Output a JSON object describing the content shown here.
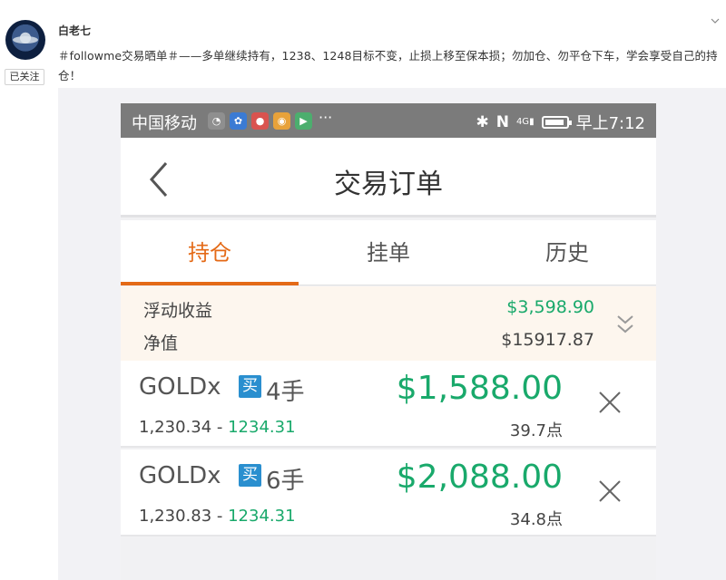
{
  "post": {
    "username": "白老七",
    "follow_label": "已关注",
    "text": "＃followme交易晒单＃——多单继续持有，1238、1248目标不变，止损上移至保本损；勿加仓、勿平仓下车，学会享受自己的持仓！"
  },
  "phone": {
    "status_bar": {
      "carrier": "中国移动",
      "more": "···",
      "network": "4G",
      "time": "早上7:12"
    },
    "title": "交易订单",
    "tabs": [
      {
        "label": "持仓",
        "active": true
      },
      {
        "label": "挂单",
        "active": false
      },
      {
        "label": "历史",
        "active": false
      }
    ],
    "summary": {
      "floating_label": "浮动收益",
      "floating_value": "$3,598.90",
      "equity_label": "净值",
      "equity_value": "$15917.87"
    },
    "orders": [
      {
        "symbol": "GOLDx",
        "side": "买",
        "lots": "4手",
        "profit": "$1,588.00",
        "open": "1,230.34",
        "sep": " - ",
        "target": "1234.31",
        "points": "39.7点"
      },
      {
        "symbol": "GOLDx",
        "side": "买",
        "lots": "6手",
        "profit": "$2,088.00",
        "open": "1,230.83",
        "sep": " - ",
        "target": "1234.31",
        "points": "34.8点"
      }
    ]
  },
  "colors": {
    "accent_orange": "#e46a17",
    "profit_green": "#19a96b",
    "badge_blue": "#2a8fcf",
    "status_bar_gray": "#7b7b7b"
  }
}
